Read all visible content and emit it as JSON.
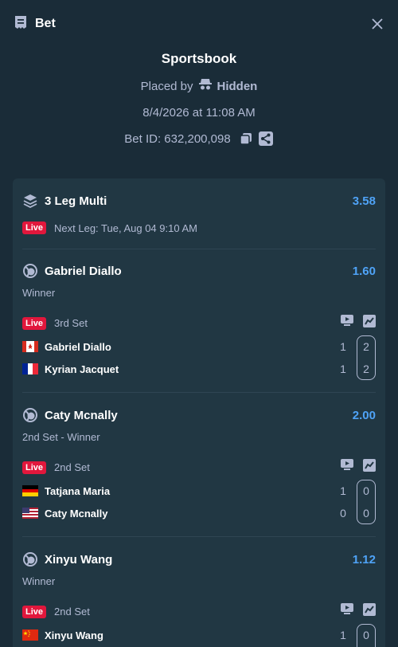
{
  "header": {
    "title": "Bet"
  },
  "summary": {
    "book": "Sportsbook",
    "placed_by_label": "Placed by",
    "placed_by_user": "Hidden",
    "datetime": "8/4/2026 at 11:08 AM",
    "bet_id": "Bet ID: 632,200,098"
  },
  "multi": {
    "title": "3 Leg Multi",
    "odds": "3.58",
    "live": "Live",
    "next_leg": "Next Leg: Tue, Aug 04 9:10 AM"
  },
  "legs": [
    {
      "selection": "Gabriel Diallo",
      "odds": "1.60",
      "market": "Winner",
      "live": "Live",
      "period": "3rd Set",
      "players": [
        {
          "name": "Gabriel Diallo",
          "flag": "canada",
          "sets": "1",
          "games": "2"
        },
        {
          "name": "Kyrian Jacquet",
          "flag": "france",
          "sets": "1",
          "games": "2"
        }
      ]
    },
    {
      "selection": "Caty Mcnally",
      "odds": "2.00",
      "market": "2nd Set - Winner",
      "live": "Live",
      "period": "2nd Set",
      "players": [
        {
          "name": "Tatjana Maria",
          "flag": "germany",
          "sets": "1",
          "games": "0"
        },
        {
          "name": "Caty Mcnally",
          "flag": "usa",
          "sets": "0",
          "games": "0"
        }
      ]
    },
    {
      "selection": "Xinyu Wang",
      "odds": "1.12",
      "market": "Winner",
      "live": "Live",
      "period": "2nd Set",
      "players": [
        {
          "name": "Xinyu Wang",
          "flag": "china",
          "sets": "1",
          "games": "0"
        }
      ]
    }
  ],
  "icons": {
    "bet": "bet-slip-icon",
    "close": "close-icon",
    "incognito": "incognito-icon",
    "copy": "copy-icon",
    "share": "share-icon",
    "multi": "layers-icon",
    "sport": "tennis-ball-icon",
    "stream": "live-stream-icon",
    "stats": "stats-icon"
  },
  "colors": {
    "bg": "#1a2c38",
    "card": "#213743",
    "odds": "#4fa3f7",
    "live": "#e1173c"
  }
}
